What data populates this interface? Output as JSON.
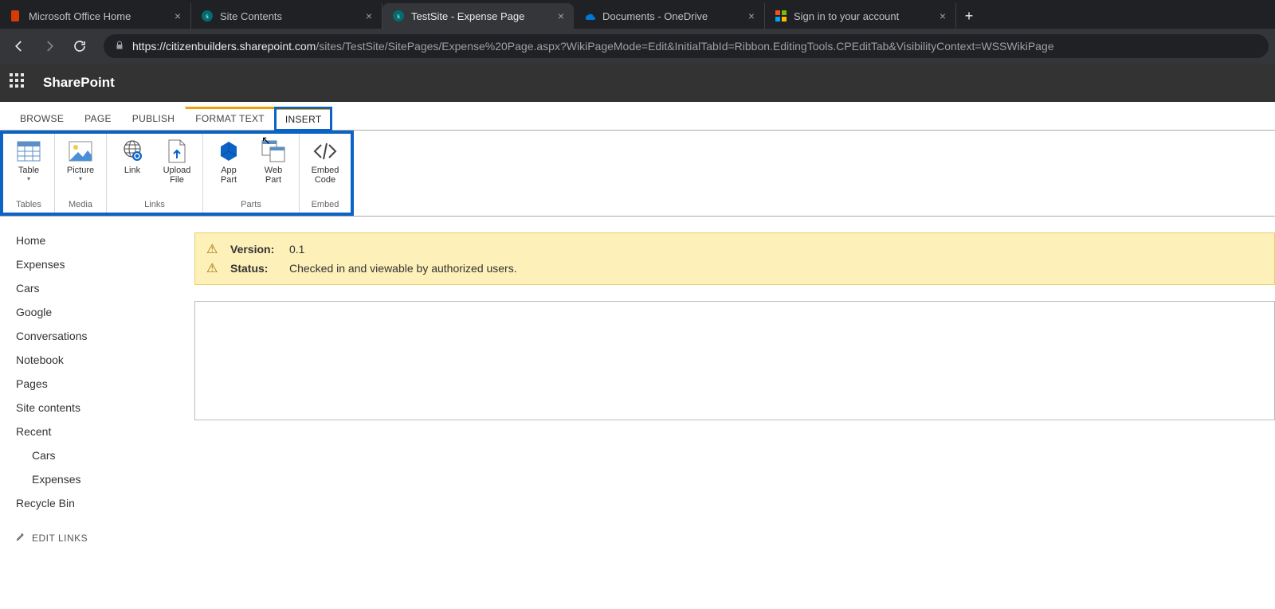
{
  "browser": {
    "tabs": [
      {
        "title": "Microsoft Office Home",
        "favicon": "office"
      },
      {
        "title": "Site Contents",
        "favicon": "sharepoint"
      },
      {
        "title": "TestSite - Expense Page",
        "favicon": "sharepoint",
        "active": true
      },
      {
        "title": "Documents - OneDrive",
        "favicon": "onedrive"
      },
      {
        "title": "Sign in to your account",
        "favicon": "microsoft"
      }
    ],
    "url_host": "https://citizenbuilders.sharepoint.com",
    "url_path": "/sites/TestSite/SitePages/Expense%20Page.aspx?WikiPageMode=Edit&InitialTabId=Ribbon.EditingTools.CPEditTab&VisibilityContext=WSSWikiPage"
  },
  "suite": {
    "title": "SharePoint"
  },
  "ribbon": {
    "tabs": [
      "BROWSE",
      "PAGE",
      "PUBLISH",
      "FORMAT TEXT",
      "INSERT"
    ],
    "active_tab": "INSERT",
    "groups": [
      {
        "label": "Tables",
        "items": [
          {
            "name": "table",
            "label": "Table",
            "dropdown": true
          }
        ]
      },
      {
        "label": "Media",
        "items": [
          {
            "name": "picture",
            "label": "Picture",
            "dropdown": true
          }
        ]
      },
      {
        "label": "Links",
        "items": [
          {
            "name": "link",
            "label": "Link"
          },
          {
            "name": "upload-file",
            "label": "Upload\nFile"
          }
        ]
      },
      {
        "label": "Parts",
        "items": [
          {
            "name": "app-part",
            "label": "App\nPart"
          },
          {
            "name": "web-part",
            "label": "Web\nPart"
          }
        ]
      },
      {
        "label": "Embed",
        "items": [
          {
            "name": "embed-code",
            "label": "Embed\nCode"
          }
        ]
      }
    ]
  },
  "leftnav": {
    "links": [
      "Home",
      "Expenses",
      "Cars",
      "Google",
      "Conversations",
      "Notebook",
      "Pages",
      "Site contents",
      "Recent"
    ],
    "recent": [
      "Cars",
      "Expenses"
    ],
    "tail": [
      "Recycle Bin"
    ],
    "edit_links": "EDIT LINKS"
  },
  "status": {
    "rows": [
      {
        "key": "Version:",
        "value": "0.1"
      },
      {
        "key": "Status:",
        "value": "Checked in and viewable by authorized users."
      }
    ]
  }
}
